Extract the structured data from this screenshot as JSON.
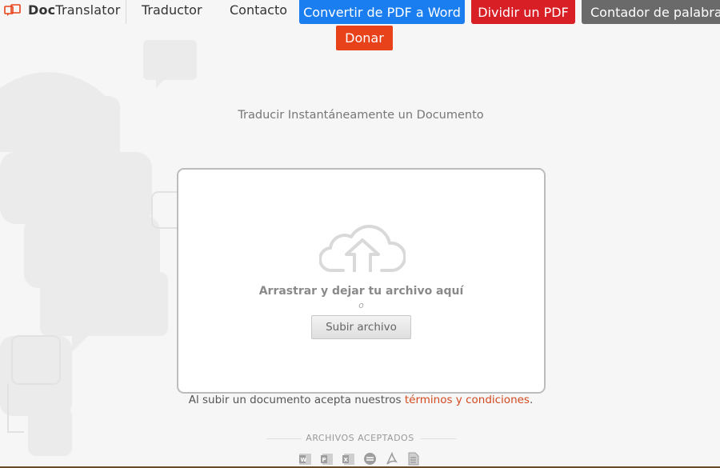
{
  "header": {
    "brand": {
      "bold": "Doc",
      "rest": "Translator"
    },
    "nav": [
      {
        "label": "Traductor"
      },
      {
        "label": "Contacto"
      }
    ],
    "buttons": {
      "pdf_to_word": "Convertir de PDF a Word",
      "split_pdf": "Dividir un PDF",
      "word_counter": "Contador de palabras"
    },
    "donate": "Donar"
  },
  "main": {
    "title": "Traducir Instantáneamente un Documento",
    "dropzone": {
      "drop_text": "Arrastrar y dejar tu archivo aquí",
      "or_text": "o",
      "upload_label": "Subir archivo"
    },
    "terms": {
      "prefix": "Al subir un documento acepta nuestros ",
      "link": "términos y condiciones",
      "suffix": "."
    },
    "accepted": {
      "label": "ARCHIVOS ACEPTADOS",
      "formats": [
        "word-doc-icon",
        "powerpoint-icon",
        "excel-icon",
        "opendoc-icon",
        "pdf-icon",
        "text-file-icon"
      ]
    }
  },
  "colors": {
    "blue": "#1a7df0",
    "red": "#d91f26",
    "gray": "#6a6a6a",
    "donate": "#e8421b",
    "link": "#d2491f"
  }
}
